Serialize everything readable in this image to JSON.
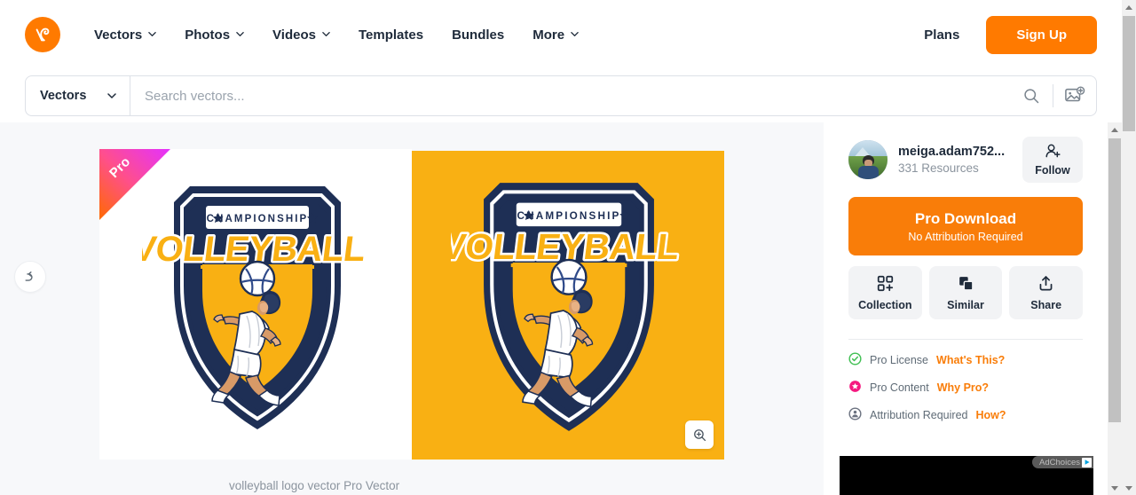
{
  "header": {
    "logo_icon": "vecteezy-logo-icon",
    "nav": [
      {
        "label": "Vectors",
        "has_caret": true
      },
      {
        "label": "Photos",
        "has_caret": true
      },
      {
        "label": "Videos",
        "has_caret": true
      },
      {
        "label": "Templates",
        "has_caret": false
      },
      {
        "label": "Bundles",
        "has_caret": false
      },
      {
        "label": "More",
        "has_caret": true
      }
    ],
    "plans_label": "Plans",
    "signup_label": "Sign Up",
    "brand_color": "#ff7a00"
  },
  "search": {
    "category": "Vectors",
    "placeholder": "Search vectors...",
    "value": "",
    "search_icon": "search-icon",
    "image_search_icon": "image-search-icon"
  },
  "content": {
    "back_icon": "back-arrow-icon",
    "pro_badge": "Pro",
    "zoom_icon": "magnify-plus-icon",
    "caption": "volleyball logo vector Pro Vector",
    "artwork": {
      "title_text": "VOLLEYBALL",
      "banner_text": "CHAMPIONSHIP",
      "navy": "#1e2f55",
      "gold": "#f9b013",
      "white": "#ffffff"
    },
    "preview_background": "#f9b013"
  },
  "sidebar": {
    "author": {
      "name": "meiga.adam752...",
      "resources": "331 Resources",
      "avatar": "user-avatar"
    },
    "follow": {
      "label": "Follow",
      "icon": "user-plus-icon"
    },
    "download": {
      "title": "Pro Download",
      "subtitle": "No Attribution Required",
      "color": "#f97d09"
    },
    "actions": [
      {
        "label": "Collection",
        "icon": "collection-grid-plus-icon"
      },
      {
        "label": "Similar",
        "icon": "similar-copy-icon"
      },
      {
        "label": "Share",
        "icon": "share-upload-icon"
      }
    ],
    "license": [
      {
        "label": "Pro License",
        "link": "What's This?",
        "icon": "check-circle-icon",
        "color": "#3fbf52"
      },
      {
        "label": "Pro Content",
        "link": "Why Pro?",
        "icon": "star-circle-icon",
        "color": "#f5187f"
      },
      {
        "label": "Attribution Required",
        "link": "How?",
        "icon": "person-circle-icon",
        "color": "#6b7280"
      }
    ]
  },
  "ad": {
    "adchoices_label": "AdChoices",
    "adchoices_icon": "adchoices-triangle-icon"
  }
}
